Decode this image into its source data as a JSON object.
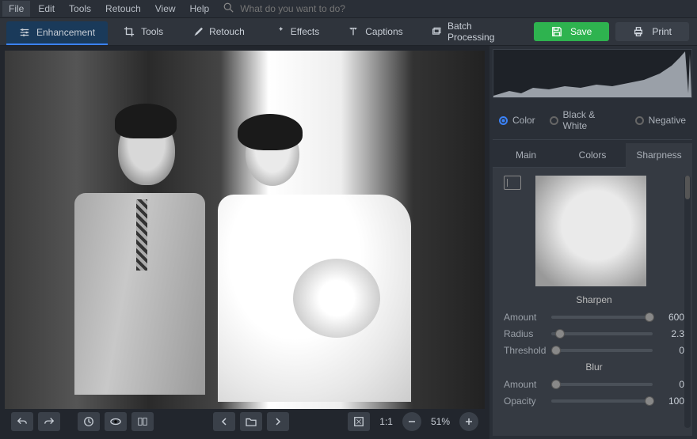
{
  "menu": {
    "file": "File",
    "edit": "Edit",
    "tools": "Tools",
    "retouch": "Retouch",
    "view": "View",
    "help": "Help",
    "search_placeholder": "What do you want to do?"
  },
  "toolbar": {
    "enhancement": "Enhancement",
    "tools": "Tools",
    "retouch": "Retouch",
    "effects": "Effects",
    "captions": "Captions",
    "batch": "Batch Processing",
    "save": "Save",
    "print": "Print"
  },
  "bottom": {
    "ratio": "1:1",
    "zoom": "51%"
  },
  "modes": {
    "color": "Color",
    "bw": "Black & White",
    "neg": "Negative"
  },
  "tabs": {
    "main": "Main",
    "colors": "Colors",
    "sharpness": "Sharpness"
  },
  "sharpen": {
    "title": "Sharpen",
    "amount_lbl": "Amount",
    "amount_val": "600",
    "radius_lbl": "Radius",
    "radius_val": "2.3",
    "threshold_lbl": "Threshold",
    "threshold_val": "0"
  },
  "blur": {
    "title": "Blur",
    "amount_lbl": "Amount",
    "amount_val": "0",
    "opacity_lbl": "Opacity",
    "opacity_val": "100"
  }
}
